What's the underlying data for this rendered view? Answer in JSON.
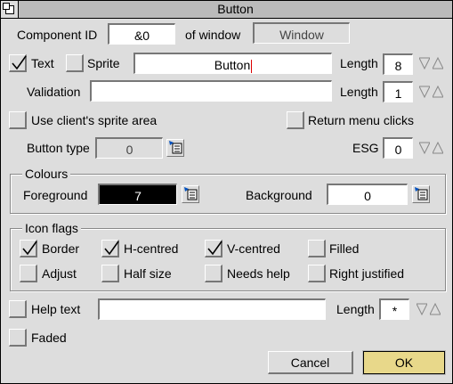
{
  "window": {
    "title": "Button"
  },
  "component_id": {
    "label": "Component ID",
    "value": "&0",
    "window_label": "of window",
    "window_value": "Window"
  },
  "text_row": {
    "text_label": "Text",
    "text_checked": true,
    "sprite_label": "Sprite",
    "sprite_checked": false,
    "value": "Button",
    "length_label": "Length",
    "length_value": "8"
  },
  "validation_row": {
    "label": "Validation",
    "value": "",
    "length_label": "Length",
    "length_value": "1"
  },
  "sprite_area": {
    "label": "Use client's sprite area",
    "checked": false
  },
  "return_menu": {
    "label": "Return menu clicks",
    "checked": false
  },
  "button_type": {
    "label": "Button type",
    "value": "0"
  },
  "esg": {
    "label": "ESG",
    "value": "0"
  },
  "colours": {
    "title": "Colours",
    "foreground_label": "Foreground",
    "foreground_value": "7",
    "background_label": "Background",
    "background_value": "0"
  },
  "icon_flags": {
    "title": "Icon flags",
    "border": {
      "label": "Border",
      "checked": true
    },
    "h_centred": {
      "label": "H-centred",
      "checked": true
    },
    "v_centred": {
      "label": "V-centred",
      "checked": true
    },
    "filled": {
      "label": "Filled",
      "checked": false
    },
    "adjust": {
      "label": "Adjust",
      "checked": false
    },
    "half_size": {
      "label": "Half size",
      "checked": false
    },
    "needs_help": {
      "label": "Needs help",
      "checked": false
    },
    "right_justified": {
      "label": "Right justified",
      "checked": false
    }
  },
  "help_text": {
    "label": "Help text",
    "checked": false,
    "value": "",
    "length_label": "Length",
    "length_value": "*"
  },
  "faded": {
    "label": "Faded",
    "checked": false
  },
  "buttons": {
    "cancel": "Cancel",
    "ok": "OK"
  },
  "colors": {
    "ok_button_bg": "#e8d88a",
    "window_bg": "#dddddd",
    "title_bg": "#bbbbbb",
    "caret": "#dd0000"
  }
}
